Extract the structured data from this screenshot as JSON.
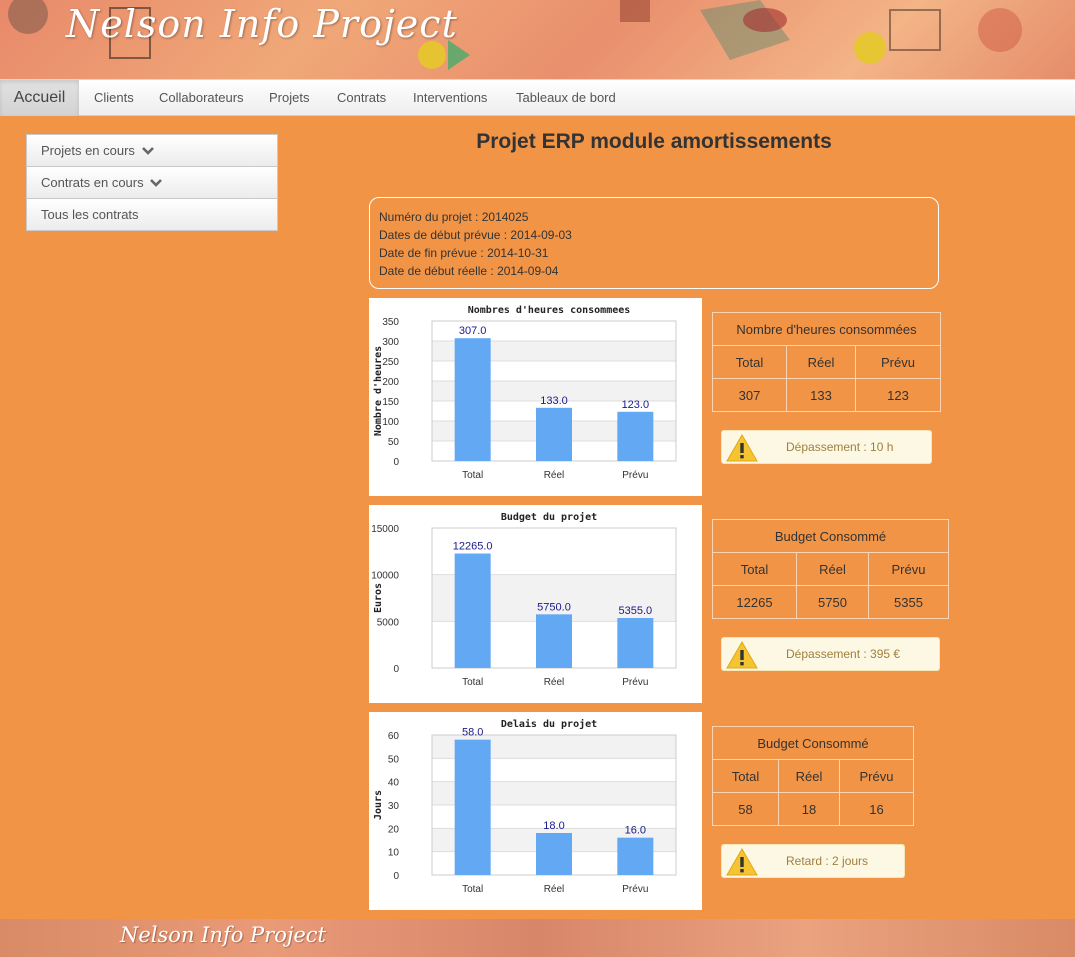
{
  "header": {
    "title": "Nelson Info Project"
  },
  "nav": {
    "items": [
      {
        "label": "Accueil"
      },
      {
        "label": "Clients"
      },
      {
        "label": "Collaborateurs"
      },
      {
        "label": "Projets"
      },
      {
        "label": "Contrats"
      },
      {
        "label": "Interventions"
      },
      {
        "label": "Tableaux de bord"
      }
    ],
    "active": "Accueil"
  },
  "sidebar": {
    "items": [
      {
        "label": "Projets en cours",
        "icon": "chevron-down-icon"
      },
      {
        "label": "Contrats en cours",
        "icon": "chevron-down-icon"
      },
      {
        "label": "Tous les contrats"
      }
    ]
  },
  "page": {
    "title": "Projet ERP module amortissements"
  },
  "info": {
    "lines": [
      "Numéro du projet : 2014025",
      "Dates de début prévue : 2014-09-03",
      "Date de fin prévue : 2014-10-31",
      "Date de début réelle : 2014-09-04"
    ]
  },
  "tables": [
    {
      "title": "Nombre d'heures consommées",
      "headers": [
        "Total",
        "Réel",
        "Prévu"
      ],
      "values": [
        "307",
        "133",
        "123"
      ]
    },
    {
      "title": "Budget Consommé",
      "headers": [
        "Total",
        "Réel",
        "Prévu"
      ],
      "values": [
        "12265",
        "5750",
        "5355"
      ]
    },
    {
      "title": "Budget Consommé",
      "headers": [
        "Total",
        "Réel",
        "Prévu"
      ],
      "values": [
        "58",
        "18",
        "16"
      ]
    }
  ],
  "alerts": [
    {
      "text": "Dépassement : 10 h",
      "icon": "warning-icon"
    },
    {
      "text": "Dépassement : 395 €",
      "icon": "warning-icon"
    },
    {
      "text": "Retard : 2 jours",
      "icon": "warning-icon"
    }
  ],
  "footer": {
    "title": "Nelson Info Project"
  },
  "colors": {
    "background": "#f29446",
    "bar": "#62a8f2",
    "value_label": "#1a1a8c",
    "alert_bg": "#fcf8e3",
    "alert_text": "#a07f3e"
  },
  "chart_data": [
    {
      "type": "bar",
      "title": "Nombres d'heures consommees",
      "ylabel": "Nombre d'heures",
      "xlabel": "",
      "categories": [
        "Total",
        "Réel",
        "Prévu"
      ],
      "values": [
        307.0,
        133.0,
        123.0
      ],
      "value_labels": [
        "307.0",
        "133.0",
        "123.0"
      ],
      "ylim": [
        0,
        350
      ],
      "yticks": [
        0,
        50,
        100,
        150,
        200,
        250,
        300,
        350
      ],
      "grid": "banded"
    },
    {
      "type": "bar",
      "title": "Budget du projet",
      "ylabel": "Euros",
      "xlabel": "",
      "categories": [
        "Total",
        "Réel",
        "Prévu"
      ],
      "values": [
        12265.0,
        5750.0,
        5355.0
      ],
      "value_labels": [
        "12265.0",
        "5750.0",
        "5355.0"
      ],
      "ylim": [
        0,
        15000
      ],
      "yticks": [
        0,
        5000,
        10000,
        15000
      ],
      "grid": "banded"
    },
    {
      "type": "bar",
      "title": "Delais du projet",
      "ylabel": "Jours",
      "xlabel": "",
      "categories": [
        "Total",
        "Réel",
        "Prévu"
      ],
      "values": [
        58.0,
        18.0,
        16.0
      ],
      "value_labels": [
        "58.0",
        "18.0",
        "16.0"
      ],
      "ylim": [
        0,
        60
      ],
      "yticks": [
        0,
        10,
        20,
        30,
        40,
        50,
        60
      ],
      "grid": "banded"
    }
  ]
}
